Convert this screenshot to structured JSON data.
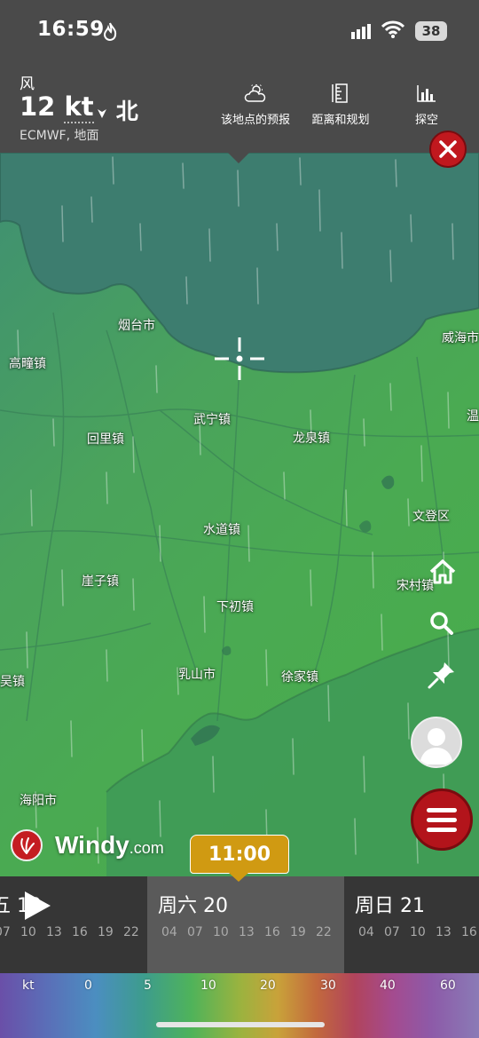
{
  "status_bar": {
    "time": "16:59",
    "battery": "38",
    "icons": [
      "flame-icon",
      "signal-icon",
      "wifi-icon",
      "battery-icon"
    ]
  },
  "header": {
    "layer_label": "风",
    "wind_value": "12",
    "wind_unit": "kt",
    "wind_direction": "北",
    "model": "ECMWF, 地面",
    "buttons": [
      {
        "label": "该地点的预报",
        "icon": "weather-cloud-icon"
      },
      {
        "label": "距离和规划",
        "icon": "ruler-icon"
      },
      {
        "label": "探空",
        "icon": "bar-chart-icon"
      }
    ]
  },
  "map": {
    "places": [
      {
        "name": "烟台市"
      },
      {
        "name": "高疃镇"
      },
      {
        "name": "威海市"
      },
      {
        "name": "温"
      },
      {
        "name": "武宁镇"
      },
      {
        "name": "回里镇"
      },
      {
        "name": "龙泉镇"
      },
      {
        "name": "文登区"
      },
      {
        "name": "水道镇"
      },
      {
        "name": "崖子镇"
      },
      {
        "name": "宋村镇"
      },
      {
        "name": "下初镇"
      },
      {
        "name": "乳山市"
      },
      {
        "name": "徐家镇"
      },
      {
        "name": "吴镇"
      },
      {
        "name": "海阳市"
      }
    ],
    "right_buttons": [
      "home-icon",
      "search-icon",
      "pin-icon"
    ],
    "colors": {
      "map_green": "#4aaa52",
      "close_red": "#c0181e"
    }
  },
  "logo": {
    "word": "Windy",
    "suffix": ".com"
  },
  "time_bubble": "11:00",
  "timeline": {
    "days": [
      {
        "title": "五 19",
        "hours": [
          "07",
          "10",
          "13",
          "16",
          "19",
          "22"
        ]
      },
      {
        "title": "周六 20",
        "hours": [
          "04",
          "07",
          "10",
          "13",
          "16",
          "19",
          "22"
        ]
      },
      {
        "title": "周日 21",
        "hours": [
          "04",
          "07",
          "10",
          "13",
          "16"
        ]
      }
    ]
  },
  "legend": {
    "unit": "kt",
    "values": [
      "0",
      "5",
      "10",
      "20",
      "30",
      "40",
      "60"
    ]
  }
}
